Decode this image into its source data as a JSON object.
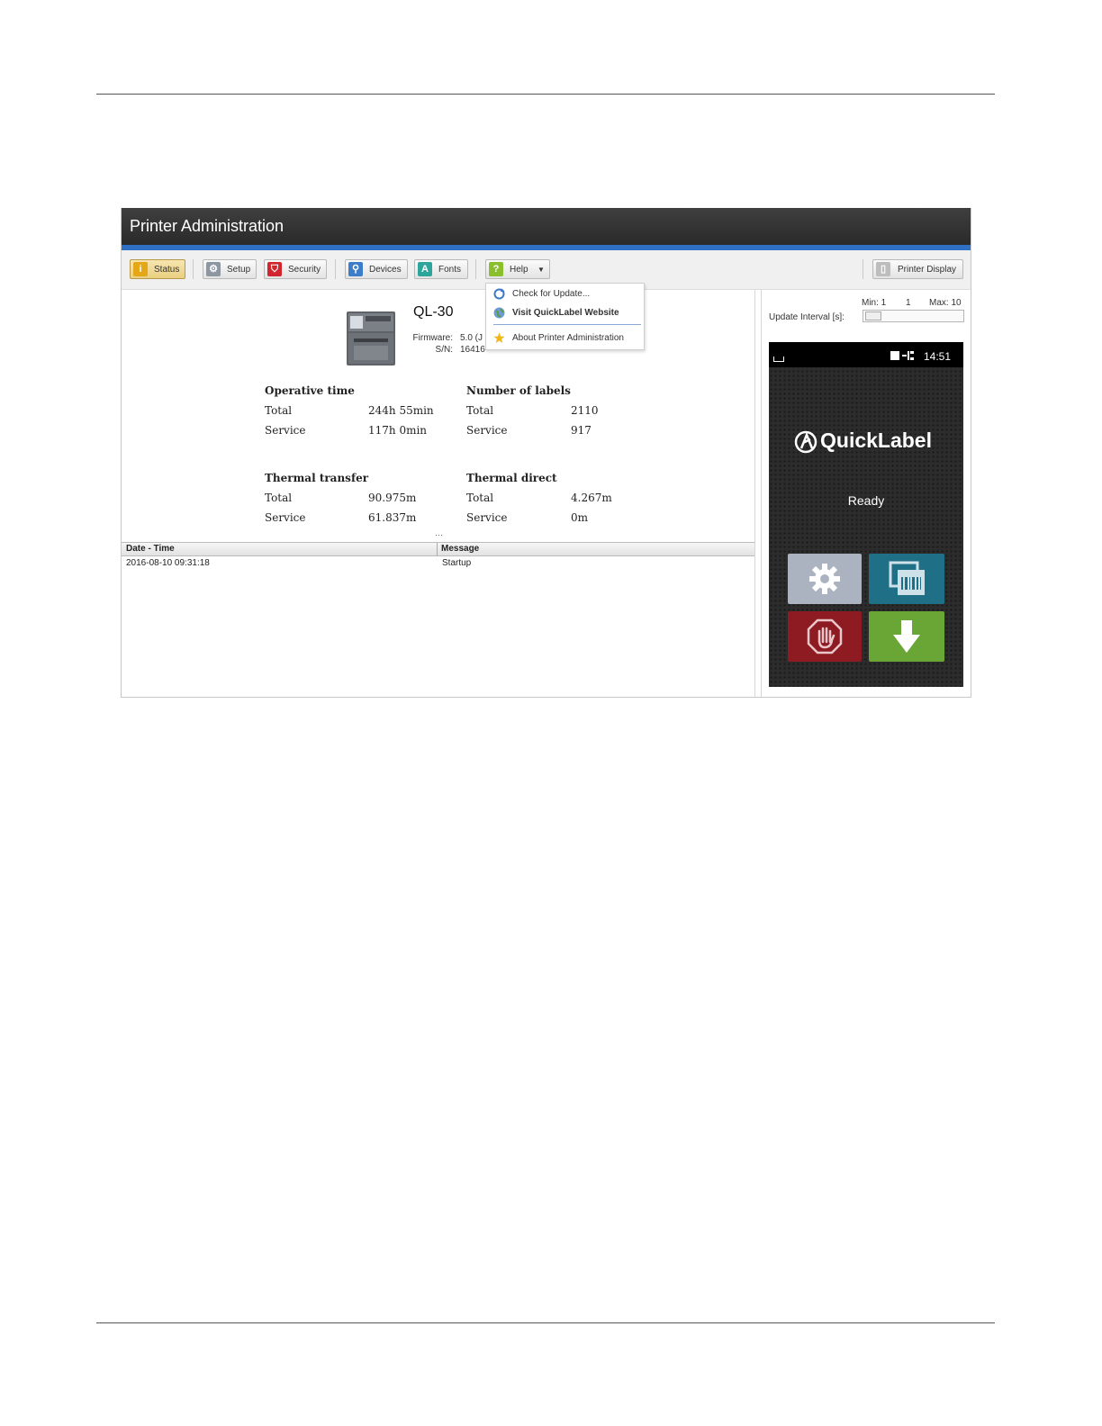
{
  "window": {
    "title": "Printer Administration"
  },
  "toolbar": {
    "status": "Status",
    "setup": "Setup",
    "security": "Security",
    "devices": "Devices",
    "fonts": "Fonts",
    "help": "Help",
    "printer_display": "Printer Display"
  },
  "help_menu": {
    "items": [
      {
        "label": "Check for Update...",
        "icon": "refresh-icon"
      },
      {
        "label": "Visit QuickLabel Website",
        "icon": "globe-icon"
      },
      {
        "label": "About Printer Administration",
        "icon": "star-icon"
      }
    ]
  },
  "printer": {
    "model": "QL-30",
    "firmware_label": "Firmware:",
    "firmware_value": "5.0 (J",
    "sn_label": "S/N:",
    "sn_value": "16416"
  },
  "stats": {
    "operative_time": {
      "title": "Operative time",
      "total_label": "Total",
      "total": "244h 55min",
      "service_label": "Service",
      "service": "117h 0min"
    },
    "number_of_labels": {
      "title": "Number of labels",
      "total_label": "Total",
      "total": "2110",
      "service_label": "Service",
      "service": "917"
    },
    "thermal_transfer": {
      "title": "Thermal transfer",
      "total_label": "Total",
      "total": "90.975m",
      "service_label": "Service",
      "service": "61.837m"
    },
    "thermal_direct": {
      "title": "Thermal direct",
      "total_label": "Total",
      "total": "4.267m",
      "service_label": "Service",
      "service": "0m"
    }
  },
  "log": {
    "columns": [
      "Date - Time",
      "Message"
    ],
    "rows": [
      {
        "datetime": "2016-08-10 09:31:18",
        "message": "Startup"
      }
    ]
  },
  "update_interval": {
    "label": "Update Interval [s]:",
    "min": "Min: 1",
    "value": "1",
    "max": "Max: 10"
  },
  "display": {
    "time": "14:51",
    "logo": "QuickLabel",
    "status": "Ready"
  },
  "colors": {
    "accent": "#2f6fc4",
    "tile_settings": "#aab3bf",
    "tile_labels": "#1f6f86",
    "tile_stop": "#8e1a22",
    "tile_feed": "#6aa635"
  }
}
